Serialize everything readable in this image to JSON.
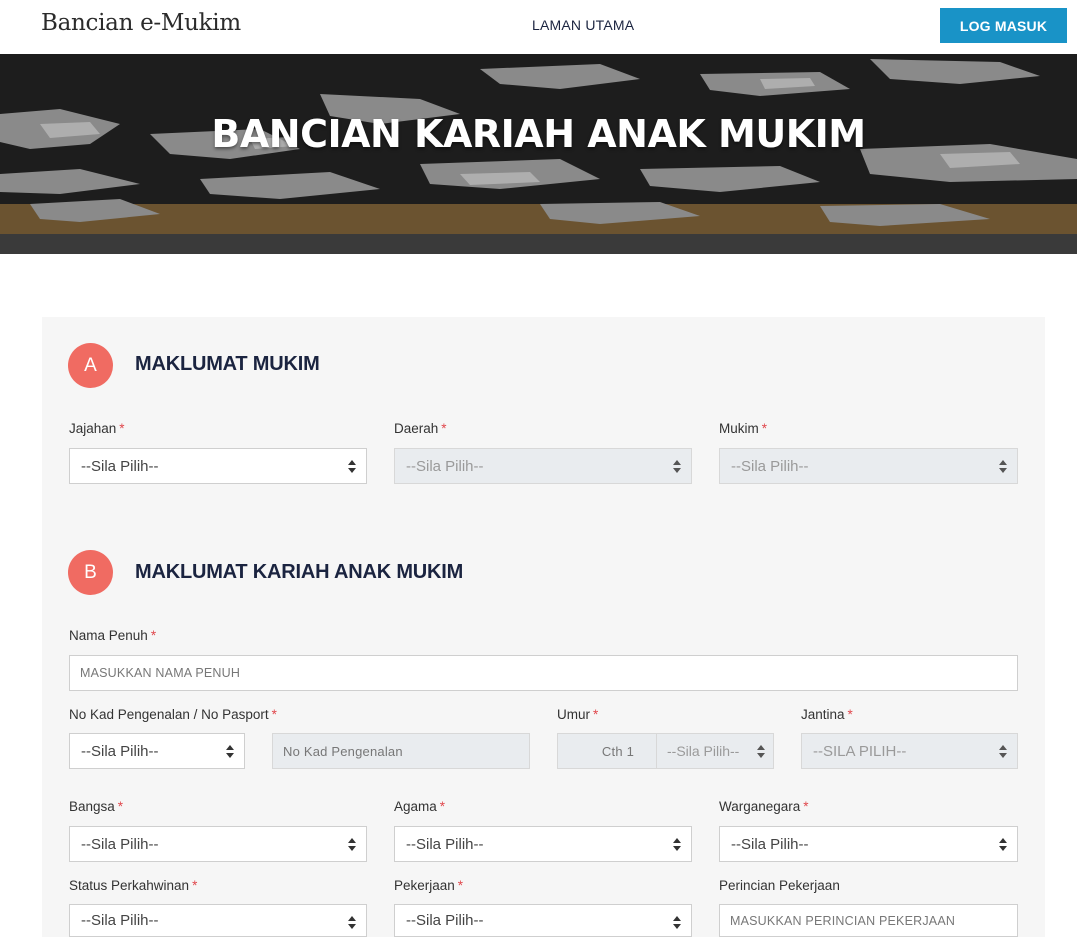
{
  "header": {
    "brand": "Bancian e-Mukim",
    "nav_home": "LAMAN UTAMA",
    "login": "LOG MASUK"
  },
  "hero": {
    "title": "BANCIAN KARIAH ANAK MUKIM"
  },
  "section_a": {
    "badge": "A",
    "title": "MAKLUMAT MUKIM",
    "jajahan": {
      "label": "Jajahan",
      "value": "--Sila Pilih--"
    },
    "daerah": {
      "label": "Daerah",
      "value": "--Sila Pilih--"
    },
    "mukim": {
      "label": "Mukim",
      "value": "--Sila Pilih--"
    }
  },
  "section_b": {
    "badge": "B",
    "title": "MAKLUMAT KARIAH ANAK MUKIM",
    "nama_penuh": {
      "label": "Nama Penuh",
      "placeholder": "MASUKKAN NAMA PENUH"
    },
    "no_kad": {
      "label": "No Kad Pengenalan / No Pasport",
      "type_value": "--Sila Pilih--",
      "placeholder": "No Kad Pengenalan"
    },
    "umur": {
      "label": "Umur",
      "placeholder": "Cth 1",
      "unit_value": "--Sila Pilih--"
    },
    "jantina": {
      "label": "Jantina",
      "value": "--SILA PILIH--"
    },
    "bangsa": {
      "label": "Bangsa",
      "value": "--Sila Pilih--"
    },
    "agama": {
      "label": "Agama",
      "value": "--Sila Pilih--"
    },
    "warganegara": {
      "label": "Warganegara",
      "value": "--Sila Pilih--"
    },
    "status_perkahwinan": {
      "label": "Status Perkahwinan",
      "value": "--Sila Pilih--"
    },
    "pekerjaan": {
      "label": "Pekerjaan",
      "value": "--Sila Pilih--"
    },
    "perincian_pekerjaan": {
      "label": "Perincian Pekerjaan",
      "placeholder": "MASUKKAN PERINCIAN PEKERJAAN"
    }
  },
  "required_mark": "*",
  "colors": {
    "accent_button": "#1993c7",
    "section_badge": "#f06b62",
    "heading": "#1b2440",
    "required": "#e0474c",
    "panel": "#f6f6f6"
  },
  "icons": [
    "select-arrows-icon"
  ]
}
